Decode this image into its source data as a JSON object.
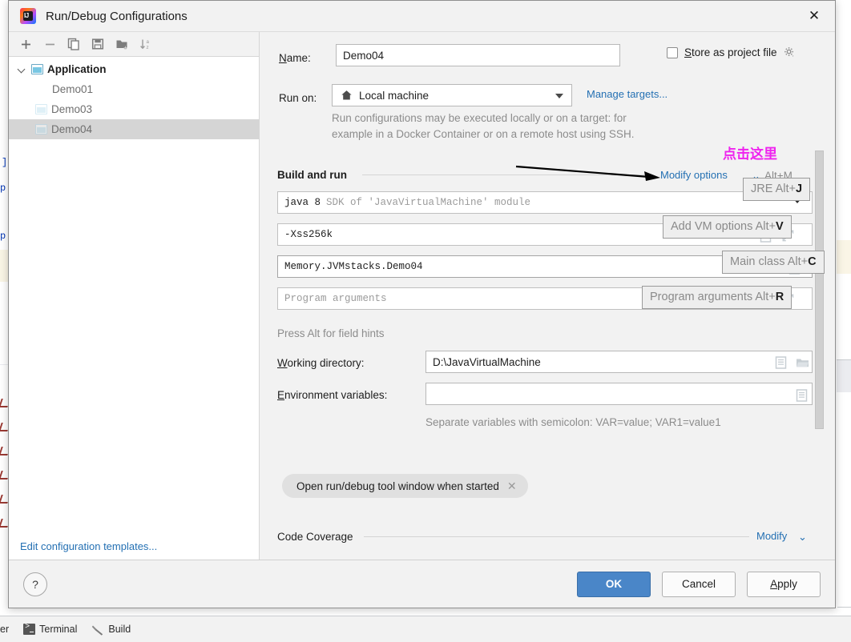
{
  "window": {
    "title": "Run/Debug Configurations",
    "app_icon_text": "IJ",
    "close_icon": "close-icon"
  },
  "sidebar": {
    "toolbar": [
      {
        "name": "add-configuration",
        "icon": "plus-icon"
      },
      {
        "name": "remove-configuration",
        "icon": "minus-icon"
      },
      {
        "name": "copy-configuration",
        "icon": "copy-icon"
      },
      {
        "name": "save-configuration",
        "icon": "save-icon"
      },
      {
        "name": "move-into-folder",
        "icon": "folder-add-icon"
      },
      {
        "name": "sort-configurations",
        "icon": "sort-alpha-icon"
      }
    ],
    "tree": {
      "group_label": "Application",
      "items": [
        {
          "label": "Demo01",
          "has_icon": false,
          "selected": false
        },
        {
          "label": "Demo03",
          "has_icon": true,
          "selected": false
        },
        {
          "label": "Demo04",
          "has_icon": true,
          "selected": true
        }
      ]
    },
    "footer_link": "Edit configuration templates..."
  },
  "form": {
    "name_label": "Name:",
    "name_label_mnemonic": "N",
    "name_value": "Demo04",
    "store_as_project_file_label": "Store as project file",
    "store_as_project_file_mnemonic": "S",
    "store_checked": false,
    "run_on_label": "Run on:",
    "run_on_value": "Local machine",
    "manage_targets_link": "Manage targets...",
    "run_on_description_line1": "Run configurations may be executed locally or on a target: for",
    "run_on_description_line2": "example in a Docker Container or on a remote host using SSH.",
    "build_and_run_title": "Build and run",
    "modify_options_link": "Modify options",
    "modify_options_shortcut": "Alt+M",
    "jre_value": "java 8",
    "jre_suffix": "SDK of 'JavaVirtualMachine' module",
    "vm_options_value": "-Xss256k",
    "main_class_value": "Memory.JVMstacks.Demo04",
    "program_arguments_placeholder": "Program arguments",
    "field_hints_text": "Press Alt for field hints",
    "working_directory_label": "Working directory:",
    "working_directory_mnemonic": "W",
    "working_directory_value": "D:\\JavaVirtualMachine",
    "environment_variables_label": "Environment variables:",
    "environment_variables_mnemonic": "E",
    "environment_variables_value": "",
    "environment_hint": "Separate variables with semicolon: VAR=value; VAR1=value1",
    "open_tool_window_chip": "Open run/debug tool window when started",
    "chip_close_icon": "close-icon",
    "code_coverage_title": "Code Coverage",
    "code_coverage_modify_link": "Modify"
  },
  "hints": [
    {
      "text": "JRE",
      "shortcut": "J",
      "prefix": "Alt+"
    },
    {
      "text": "Add VM options",
      "shortcut": "V",
      "prefix": "Alt+"
    },
    {
      "text": "Main class",
      "shortcut": "C",
      "prefix": "Alt+"
    },
    {
      "text": "Program arguments",
      "shortcut": "R",
      "prefix": "Alt+"
    }
  ],
  "annotation": {
    "text": "点击这里",
    "color": "#ef23ef"
  },
  "footer": {
    "help_label": "?",
    "ok_label": "OK",
    "cancel_label": "Cancel",
    "apply_label": "Apply",
    "apply_mnemonic": "A"
  },
  "status_bar": {
    "partial_label": "er",
    "terminal_label": "Terminal",
    "build_label": "Build"
  },
  "colors": {
    "accent_blue": "#2470b3",
    "primary_button": "#4a86c8",
    "annotation_magenta": "#ef23ef",
    "selection_grey": "#d5d5d5"
  }
}
